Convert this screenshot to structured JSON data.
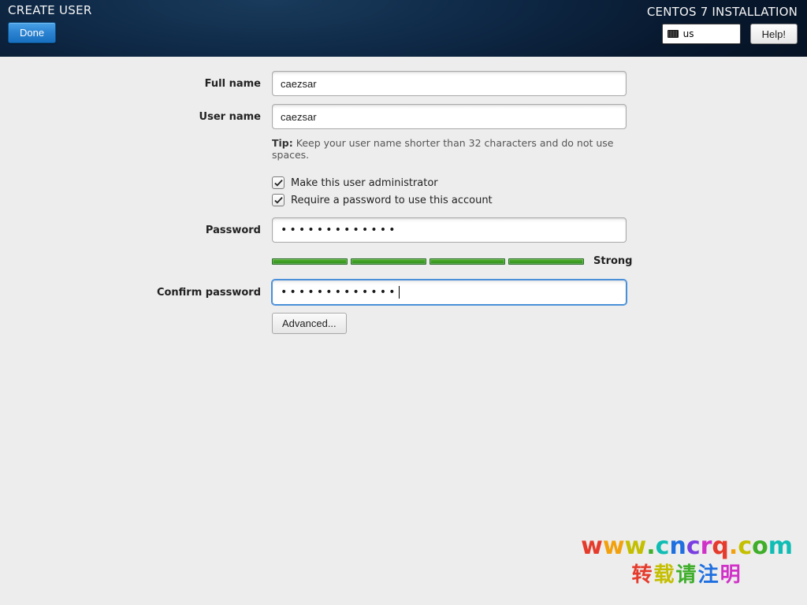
{
  "header": {
    "title": "CREATE USER",
    "done_label": "Done",
    "installer_title": "CENTOS 7 INSTALLATION",
    "keyboard_layout": "us",
    "help_label": "Help!"
  },
  "form": {
    "full_name_label": "Full name",
    "full_name_value": "caezsar",
    "user_name_label": "User name",
    "user_name_value": "caezsar",
    "tip_prefix": "Tip:",
    "tip_text": " Keep your user name shorter than 32 characters and do not use spaces.",
    "admin_checkbox_label": "Make this user administrator",
    "admin_checked": true,
    "require_password_label": "Require a password to use this account",
    "require_password_checked": true,
    "password_label": "Password",
    "password_dots": "•••••••••••••",
    "strength_label": "Strong",
    "confirm_label": "Confirm password",
    "confirm_dots": "•••••••••••••",
    "advanced_label": "Advanced..."
  },
  "watermark": {
    "line1_chars": [
      "w",
      "w",
      "w",
      ".",
      "c",
      "n",
      "c",
      "r",
      "q",
      ".",
      "c",
      "o",
      "m"
    ],
    "line2_chars": [
      "转",
      "载",
      "请",
      "注",
      "明"
    ]
  }
}
